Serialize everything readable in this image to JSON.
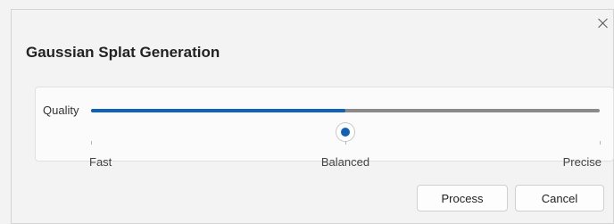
{
  "dialog": {
    "title": "Gaussian Splat Generation",
    "close_icon": "close-icon"
  },
  "quality": {
    "label": "Quality",
    "value": 0.5,
    "ticks": [
      "Fast",
      "Balanced",
      "Precise"
    ]
  },
  "buttons": {
    "process": "Process",
    "cancel": "Cancel"
  },
  "colors": {
    "accent": "#0e62b8",
    "track": "#8a8a8a",
    "background": "#f3f3f3",
    "panel": "#fbfbfb"
  }
}
